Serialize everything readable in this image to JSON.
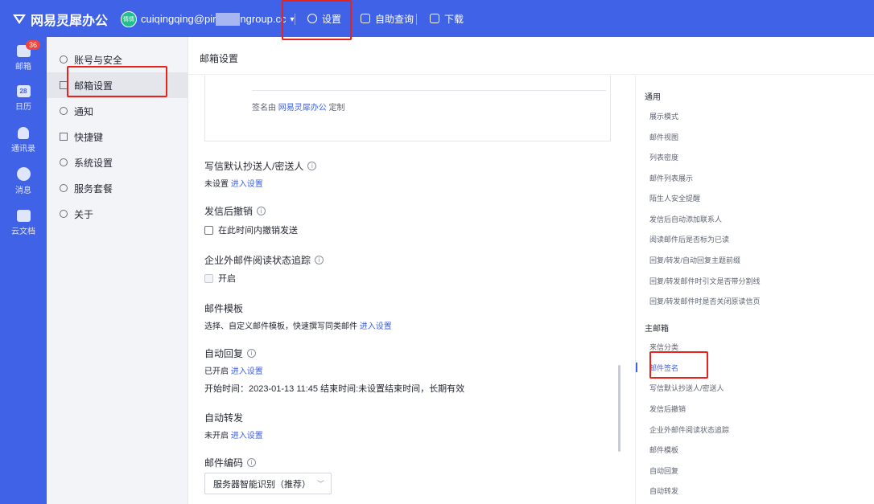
{
  "topbar": {
    "logo": "网易灵犀办公",
    "avatar_text": "情情",
    "user_email_start": "cuiqingqing@pir",
    "user_email_end": "ngroup.cc",
    "nav_settings": "设置",
    "nav_self_query": "自助查询",
    "nav_download": "下载"
  },
  "rail": {
    "mail": "邮箱",
    "mail_badge": "36",
    "calendar": "日历",
    "calendar_icon_text": "28",
    "contacts": "通讯录",
    "messages": "消息",
    "docs": "云文档"
  },
  "sidebar": {
    "items": [
      {
        "label": "账号与安全"
      },
      {
        "label": "邮箱设置"
      },
      {
        "label": "通知"
      },
      {
        "label": "快捷键"
      },
      {
        "label": "系统设置"
      },
      {
        "label": "服务套餐"
      },
      {
        "label": "关于"
      }
    ]
  },
  "main": {
    "title": "邮箱设置",
    "signature_by_prefix": "签名由",
    "signature_by_link": "网易灵犀办公",
    "signature_by_suffix": "定制",
    "cc_title": "写信默认抄送人/密送人",
    "cc_status": "未设置",
    "enter_settings": "进入设置",
    "undo_title": "发信后撤销",
    "undo_checkbox": "在此时间内撤销发送",
    "tracking_title": "企业外邮件阅读状态追踪",
    "tracking_checkbox": "开启",
    "template_title": "邮件模板",
    "template_desc": "选择、自定义邮件模板，快速撰写同类邮件",
    "autoreply_title": "自动回复",
    "autoreply_status": "已开启",
    "autoreply_time": "开始时间：2023-01-13 11:45   结束时间:未设置结束时间，长期有效",
    "forward_title": "自动转发",
    "forward_status": "未开启",
    "encoding_title": "邮件编码",
    "encoding_value": "服务器智能识别（推荐）"
  },
  "index": {
    "general": "通用",
    "general_items": [
      "展示模式",
      "邮件视图",
      "列表密度",
      "邮件列表展示",
      "陌生人安全提醒",
      "发信后自动添加联系人",
      "阅读邮件后是否标为已读",
      "回复/转发/自动回复主题前缀",
      "回复/转发邮件时引文是否带分割线",
      "回复/转发邮件时是否关闭原读信页"
    ],
    "main_mailbox": "主邮箱",
    "main_items": [
      "来信分类",
      "邮件签名",
      "写信默认抄送人/密送人",
      "发信后撤销",
      "企业外邮件阅读状态追踪",
      "邮件模板",
      "自动回复",
      "自动转发"
    ],
    "active_item": "邮件签名"
  },
  "colors": {
    "brand": "#3f62e6",
    "highlight": "#e8231f",
    "badge": "#f0433a"
  }
}
